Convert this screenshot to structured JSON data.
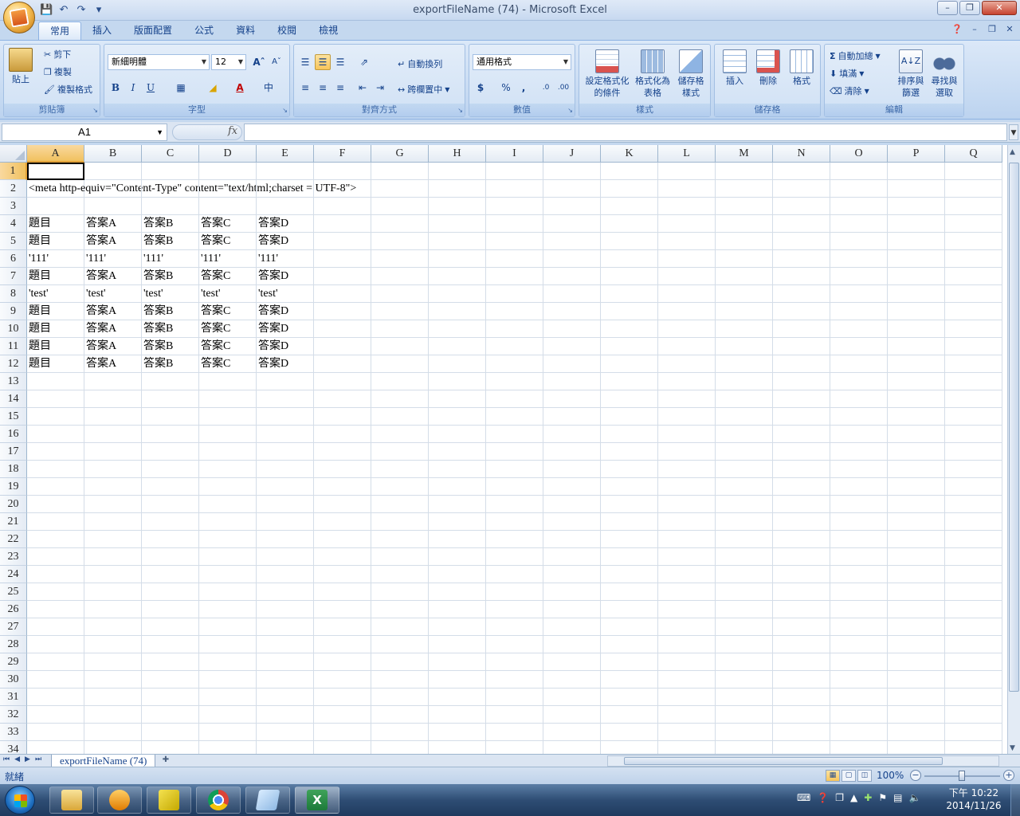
{
  "window": {
    "title": "exportFileName (74) - Microsoft Excel"
  },
  "tabs": [
    "常用",
    "插入",
    "版面配置",
    "公式",
    "資料",
    "校閱",
    "檢視"
  ],
  "ribbon": {
    "clipboard": {
      "label": "剪貼簿",
      "paste": "貼上",
      "cut": "剪下",
      "copy": "複製",
      "format_painter": "複製格式"
    },
    "font": {
      "label": "字型",
      "font_name": "新細明體",
      "font_size": "12"
    },
    "alignment": {
      "label": "對齊方式",
      "wrap_text": "自動換列",
      "merge_center": "跨欄置中"
    },
    "number": {
      "label": "數值",
      "format": "通用格式"
    },
    "styles": {
      "label": "樣式",
      "conditional": [
        "設定格式化",
        "的條件"
      ],
      "format_table": [
        "格式化為",
        "表格"
      ],
      "cell_styles": [
        "儲存格",
        "樣式"
      ]
    },
    "cells": {
      "label": "儲存格",
      "insert": "插入",
      "delete": "刪除",
      "format": "格式"
    },
    "editing": {
      "label": "編輯",
      "autosum": "自動加總",
      "fill": "填滿",
      "clear": "清除",
      "sort_filter": [
        "排序與",
        "篩選"
      ],
      "find_select": [
        "尋找與",
        "選取"
      ]
    }
  },
  "formula_bar": {
    "name_box": "A1",
    "fx": "fx",
    "formula": ""
  },
  "sheet": {
    "columns": [
      "A",
      "B",
      "C",
      "D",
      "E",
      "F",
      "G",
      "H",
      "I",
      "J",
      "K",
      "L",
      "M",
      "N",
      "O",
      "P",
      "Q"
    ],
    "row_numbers": [
      "1",
      "2",
      "3",
      "4",
      "5",
      "6",
      "7",
      "8",
      "9",
      "10",
      "11",
      "12",
      "13",
      "14",
      "15",
      "16",
      "17",
      "18",
      "19",
      "20",
      "21",
      "22",
      "23",
      "24",
      "25",
      "26",
      "27",
      "28",
      "29",
      "30",
      "31",
      "32",
      "33",
      "34"
    ],
    "active_cell": "A1",
    "rows": [
      [
        "",
        "",
        "",
        "",
        ""
      ],
      [
        "<meta http-equiv=\"Content-Type\" content=\"text/html;charset = UTF-8\">",
        "",
        "",
        "",
        ""
      ],
      [
        "",
        "",
        "",
        "",
        ""
      ],
      [
        "題目",
        "答案A",
        "答案B",
        "答案C",
        "答案D"
      ],
      [
        "題目",
        "答案A",
        "答案B",
        "答案C",
        "答案D"
      ],
      [
        "'111'",
        "'111'",
        "'111'",
        "'111'",
        "'111'"
      ],
      [
        "題目",
        "答案A",
        "答案B",
        "答案C",
        "答案D"
      ],
      [
        "'test'",
        "'test'",
        "'test'",
        "'test'",
        "'test'"
      ],
      [
        "題目",
        "答案A",
        "答案B",
        "答案C",
        "答案D"
      ],
      [
        "題目",
        "答案A",
        "答案B",
        "答案C",
        "答案D"
      ],
      [
        "題目",
        "答案A",
        "答案B",
        "答案C",
        "答案D"
      ],
      [
        "題目",
        "答案A",
        "答案B",
        "答案C",
        "答案D"
      ]
    ],
    "tab_name": "exportFileName (74)"
  },
  "status": {
    "text": "就緒",
    "zoom": "100%"
  },
  "taskbar": {
    "time": "下午 10:22",
    "date": "2014/11/26"
  },
  "colors": {
    "accent": "#15428b",
    "ribbon_bg": "#dbe8f8",
    "selection": "#f1c15f",
    "excel_green": "#1d7a3a"
  }
}
